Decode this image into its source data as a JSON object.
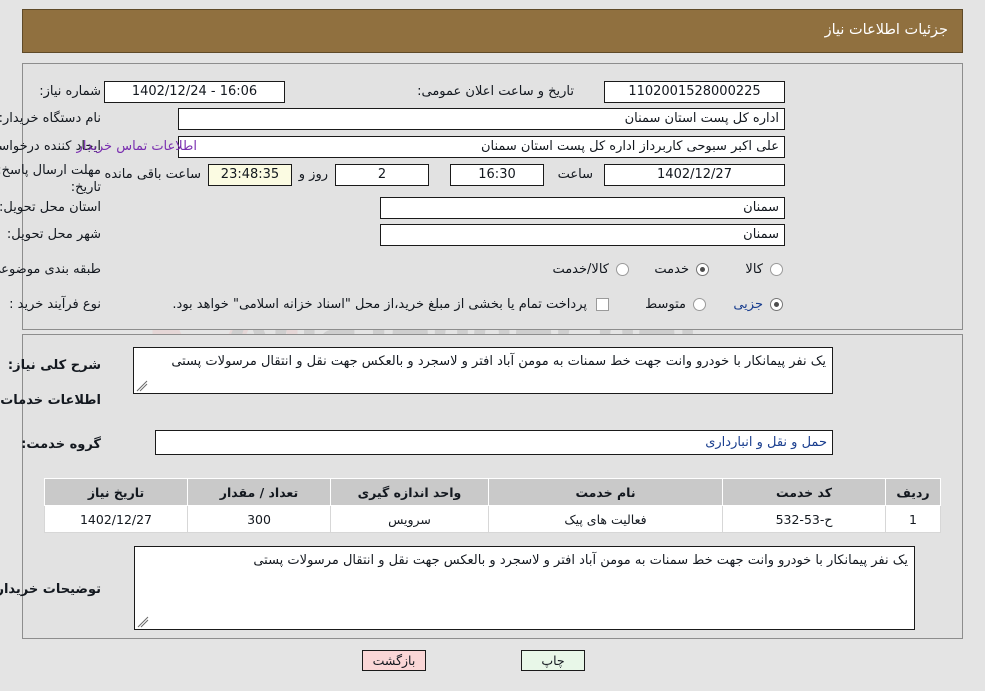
{
  "header": {
    "title": "جزئیات اطلاعات نیاز"
  },
  "watermark": {
    "text": "AriaTender.net"
  },
  "request_info": {
    "need_number_label": "شماره نیاز:",
    "need_number_value": "1102001528000225",
    "announce_label": "تاریخ و ساعت اعلان عمومی:",
    "announce_value": "16:06 - 1402/12/24",
    "buyer_org_label": "نام دستگاه خریدار:",
    "buyer_org_value": "اداره کل پست استان سمنان",
    "creator_label": "ایجاد کننده درخواست:",
    "creator_value": "علی اکبر سبوحی کاربرداز اداره کل پست استان سمنان",
    "contact_link": "اطلاعات تماس خریدار",
    "deadline_label_line1": "مهلت ارسال پاسخ: تا",
    "deadline_label_line2": "تاریخ:",
    "deadline_date": "1402/12/27",
    "deadline_time_label": "ساعت",
    "deadline_time": "16:30",
    "remaining_days": "2",
    "remaining_days_suffix": "روز و",
    "remaining_clock": "23:48:35",
    "remaining_suffix": "ساعت باقی مانده",
    "province_label": "استان محل تحویل:",
    "province_value": "سمنان",
    "city_label": "شهر محل تحویل:",
    "city_value": "سمنان",
    "category_label": "طبقه بندی موضوعی:",
    "category_options": [
      "کالا",
      "خدمت",
      "کالا/خدمت"
    ],
    "category_selected": "خدمت",
    "purchase_type_label": "نوع فرآیند خرید :",
    "purchase_type_options": [
      "جزیی",
      "متوسط"
    ],
    "purchase_type_selected": "جزیی",
    "treasury_note": "پرداخت تمام یا بخشی از مبلغ خرید،از محل \"اسناد خزانه اسلامی\" خواهد بود."
  },
  "details": {
    "summary_label": "شرح کلی نیاز:",
    "summary_value": "یک نفر پیمانکار با خودرو وانت جهت خط سمنات به مومن آباد افتر و لاسجرد  و بالعکس جهت نقل و انتقال مرسولات پستی",
    "services_heading": "اطلاعات خدمات مورد نیاز",
    "service_group_label": "گروه خدمت:",
    "service_group_value": "حمل و نقل و انبارداری",
    "buyer_notes_label": "توضیحات خریدار:",
    "buyer_notes_value": "یک نفر پیمانکار با خودرو وانت جهت خط سمنات به مومن آباد افتر و لاسجرد  و بالعکس جهت نقل و انتقال مرسولات پستی"
  },
  "table": {
    "columns": [
      "ردیف",
      "کد خدمت",
      "نام خدمت",
      "واحد اندازه گیری",
      "تعداد / مقدار",
      "تاریخ نیاز"
    ],
    "rows": [
      {
        "row_no": "1",
        "service_code": "ح-53-532",
        "service_name": "فعالیت های پیک",
        "unit": "سرویس",
        "quantity": "300",
        "need_date": "1402/12/27"
      }
    ]
  },
  "footer": {
    "print_label": "چاپ",
    "back_label": "بازگشت"
  }
}
